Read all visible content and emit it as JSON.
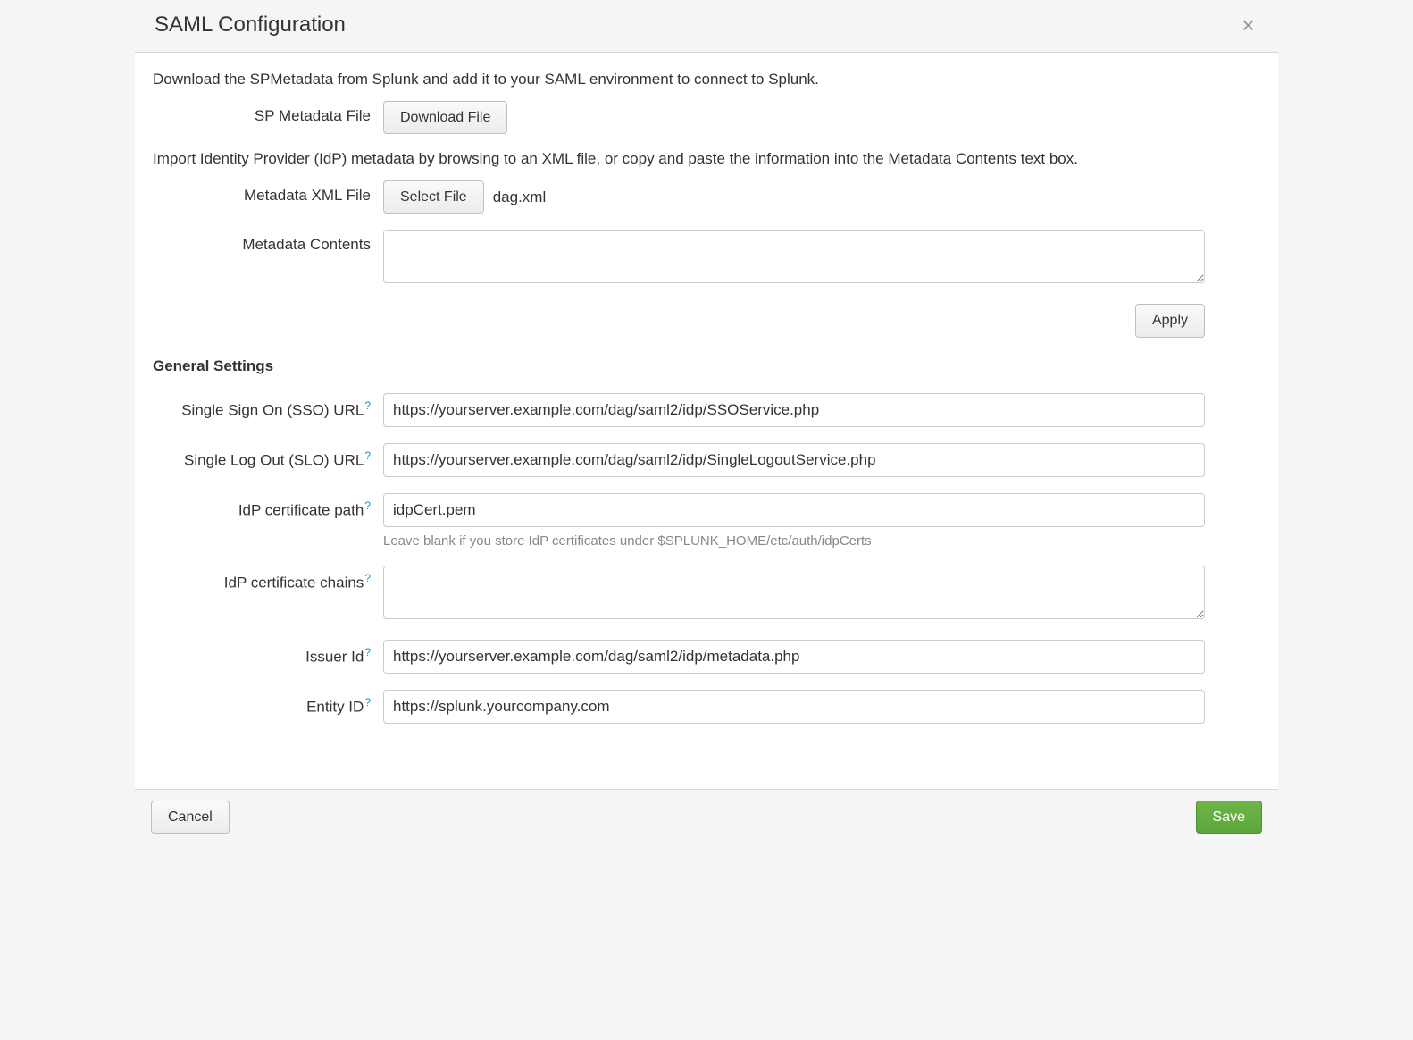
{
  "header": {
    "title": "SAML Configuration"
  },
  "intro": {
    "download_text": "Download the SPMetadata from Splunk and add it to your SAML environment to connect to Splunk.",
    "import_text": "Import Identity Provider (IdP) metadata by browsing to an XML file, or copy and paste the information into the Metadata Contents text box."
  },
  "sp_metadata": {
    "label": "SP Metadata File",
    "button": "Download File"
  },
  "metadata_xml": {
    "label": "Metadata XML File",
    "button": "Select File",
    "filename": "dag.xml"
  },
  "metadata_contents": {
    "label": "Metadata Contents",
    "value": ""
  },
  "apply_button": "Apply",
  "section_general": "General Settings",
  "fields": {
    "sso_url": {
      "label": "Single Sign On (SSO) URL",
      "value": "https://yourserver.example.com/dag/saml2/idp/SSOService.php"
    },
    "slo_url": {
      "label": "Single Log Out (SLO) URL",
      "value": "https://yourserver.example.com/dag/saml2/idp/SingleLogoutService.php"
    },
    "idp_cert_path": {
      "label": "IdP certificate path",
      "value": "idpCert.pem",
      "hint": "Leave blank if you store IdP certificates under $SPLUNK_HOME/etc/auth/idpCerts"
    },
    "idp_cert_chains": {
      "label": "IdP certificate chains",
      "value": ""
    },
    "issuer_id": {
      "label": "Issuer Id",
      "value": "https://yourserver.example.com/dag/saml2/idp/metadata.php"
    },
    "entity_id": {
      "label": "Entity ID",
      "value": "https://splunk.yourcompany.com"
    }
  },
  "footer": {
    "cancel": "Cancel",
    "save": "Save"
  },
  "help_char": "?"
}
